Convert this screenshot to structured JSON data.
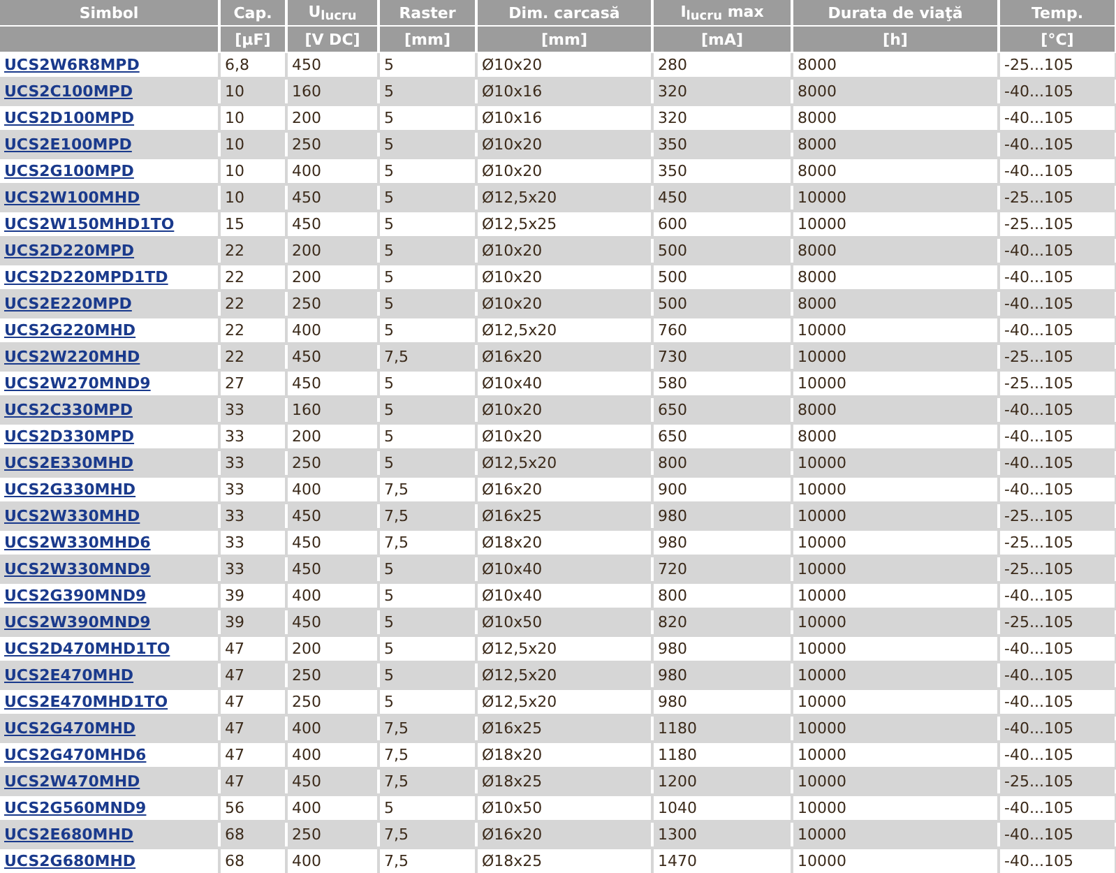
{
  "table": {
    "columns": [
      {
        "title": "Simbol"
      },
      {
        "title": "Cap.",
        "unit": "[µF]"
      },
      {
        "title": "U$_{lucru}$",
        "unit": "[V DC]"
      },
      {
        "title": "Raster",
        "unit": "[mm]"
      },
      {
        "title": "Dim. carcasă",
        "unit": "[mm]"
      },
      {
        "title": "I$_{lucru}$ max",
        "unit": "[mA]"
      },
      {
        "title": "Durata de viaţă",
        "unit": "[h]"
      },
      {
        "title": "Temp.",
        "unit": "[°C]"
      }
    ],
    "rows": [
      [
        "UCS2W6R8MPD",
        "6,8",
        "450",
        "5",
        "Ø10x20",
        "280",
        "8000",
        "-25...105"
      ],
      [
        "UCS2C100MPD",
        "10",
        "160",
        "5",
        "Ø10x16",
        "320",
        "8000",
        "-40...105"
      ],
      [
        "UCS2D100MPD",
        "10",
        "200",
        "5",
        "Ø10x16",
        "320",
        "8000",
        "-40...105"
      ],
      [
        "UCS2E100MPD",
        "10",
        "250",
        "5",
        "Ø10x20",
        "350",
        "8000",
        "-40...105"
      ],
      [
        "UCS2G100MPD",
        "10",
        "400",
        "5",
        "Ø10x20",
        "350",
        "8000",
        "-40...105"
      ],
      [
        "UCS2W100MHD",
        "10",
        "450",
        "5",
        "Ø12,5x20",
        "450",
        "10000",
        "-25...105"
      ],
      [
        "UCS2W150MHD1TO",
        "15",
        "450",
        "5",
        "Ø12,5x25",
        "600",
        "10000",
        "-25...105"
      ],
      [
        "UCS2D220MPD",
        "22",
        "200",
        "5",
        "Ø10x20",
        "500",
        "8000",
        "-40...105"
      ],
      [
        "UCS2D220MPD1TD",
        "22",
        "200",
        "5",
        "Ø10x20",
        "500",
        "8000",
        "-40...105"
      ],
      [
        "UCS2E220MPD",
        "22",
        "250",
        "5",
        "Ø10x20",
        "500",
        "8000",
        "-40...105"
      ],
      [
        "UCS2G220MHD",
        "22",
        "400",
        "5",
        "Ø12,5x20",
        "760",
        "10000",
        "-40...105"
      ],
      [
        "UCS2W220MHD",
        "22",
        "450",
        "7,5",
        "Ø16x20",
        "730",
        "10000",
        "-25...105"
      ],
      [
        "UCS2W270MND9",
        "27",
        "450",
        "5",
        "Ø10x40",
        "580",
        "10000",
        "-25...105"
      ],
      [
        "UCS2C330MPD",
        "33",
        "160",
        "5",
        "Ø10x20",
        "650",
        "8000",
        "-40...105"
      ],
      [
        "UCS2D330MPD",
        "33",
        "200",
        "5",
        "Ø10x20",
        "650",
        "8000",
        "-40...105"
      ],
      [
        "UCS2E330MHD",
        "33",
        "250",
        "5",
        "Ø12,5x20",
        "800",
        "10000",
        "-40...105"
      ],
      [
        "UCS2G330MHD",
        "33",
        "400",
        "7,5",
        "Ø16x20",
        "900",
        "10000",
        "-40...105"
      ],
      [
        "UCS2W330MHD",
        "33",
        "450",
        "7,5",
        "Ø16x25",
        "980",
        "10000",
        "-25...105"
      ],
      [
        "UCS2W330MHD6",
        "33",
        "450",
        "7,5",
        "Ø18x20",
        "980",
        "10000",
        "-25...105"
      ],
      [
        "UCS2W330MND9",
        "33",
        "450",
        "5",
        "Ø10x40",
        "720",
        "10000",
        "-25...105"
      ],
      [
        "UCS2G390MND9",
        "39",
        "400",
        "5",
        "Ø10x40",
        "800",
        "10000",
        "-40...105"
      ],
      [
        "UCS2W390MND9",
        "39",
        "450",
        "5",
        "Ø10x50",
        "820",
        "10000",
        "-25...105"
      ],
      [
        "UCS2D470MHD1TO",
        "47",
        "200",
        "5",
        "Ø12,5x20",
        "980",
        "10000",
        "-40...105"
      ],
      [
        "UCS2E470MHD",
        "47",
        "250",
        "5",
        "Ø12,5x20",
        "980",
        "10000",
        "-40...105"
      ],
      [
        "UCS2E470MHD1TO",
        "47",
        "250",
        "5",
        "Ø12,5x20",
        "980",
        "10000",
        "-40...105"
      ],
      [
        "UCS2G470MHD",
        "47",
        "400",
        "7,5",
        "Ø16x25",
        "1180",
        "10000",
        "-40...105"
      ],
      [
        "UCS2G470MHD6",
        "47",
        "400",
        "7,5",
        "Ø18x20",
        "1180",
        "10000",
        "-40...105"
      ],
      [
        "UCS2W470MHD",
        "47",
        "450",
        "7,5",
        "Ø18x25",
        "1200",
        "10000",
        "-25...105"
      ],
      [
        "UCS2G560MND9",
        "56",
        "400",
        "5",
        "Ø10x50",
        "1040",
        "10000",
        "-40...105"
      ],
      [
        "UCS2E680MHD",
        "68",
        "250",
        "7,5",
        "Ø16x20",
        "1300",
        "10000",
        "-40...105"
      ],
      [
        "UCS2G680MHD",
        "68",
        "400",
        "7,5",
        "Ø18x25",
        "1470",
        "10000",
        "-40...105"
      ]
    ]
  }
}
